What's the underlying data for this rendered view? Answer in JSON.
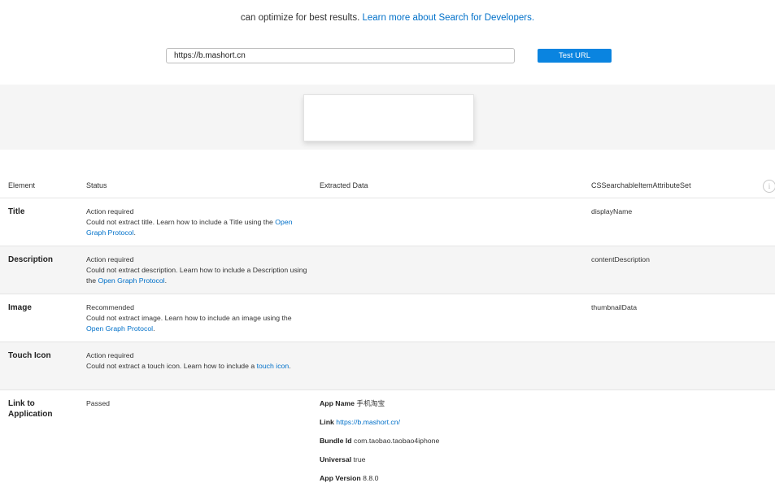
{
  "intro": {
    "text": "can optimize for best results.",
    "link": "Learn more about Search for Developers."
  },
  "search": {
    "url_value": "https://b.mashort.cn",
    "button_label": "Test URL"
  },
  "table": {
    "headers": {
      "element": "Element",
      "status": "Status",
      "extracted": "Extracted Data",
      "attribute": "CSSearchableItemAttributeSet"
    },
    "info_icon": "i",
    "rows": [
      {
        "element": "Title",
        "status": "Action required",
        "message": "Could not extract title. Learn how to include a Title using the",
        "link": "Open Graph Protocol",
        "after": ".",
        "attribute": "displayName"
      },
      {
        "element": "Description",
        "status": "Action required",
        "message": "Could not extract description. Learn how to include a Description using the",
        "link": "Open Graph Protocol",
        "after": ".",
        "attribute": "contentDescription"
      },
      {
        "element": "Image",
        "status": "Recommended",
        "message": "Could not extract image. Learn how to include an image using the",
        "link": "Open Graph Protocol",
        "after": ".",
        "attribute": "thumbnailData"
      },
      {
        "element": "Touch Icon",
        "status": "Action required",
        "message": "Could not extract a touch icon. Learn how to include a",
        "link": "touch icon",
        "after": ".",
        "attribute": ""
      },
      {
        "element": "Link to Application",
        "status": "Passed",
        "app": {
          "name_label": "App Name",
          "name_value": "手机淘宝",
          "link_label": "Link",
          "link_value": "https://b.mashort.cn/",
          "bundle_label": "Bundle Id",
          "bundle_value": "com.taobao.taobao4iphone",
          "universal_label": "Universal",
          "universal_value": "true",
          "version_label": "App Version",
          "version_value": "8.8.0"
        }
      }
    ]
  }
}
